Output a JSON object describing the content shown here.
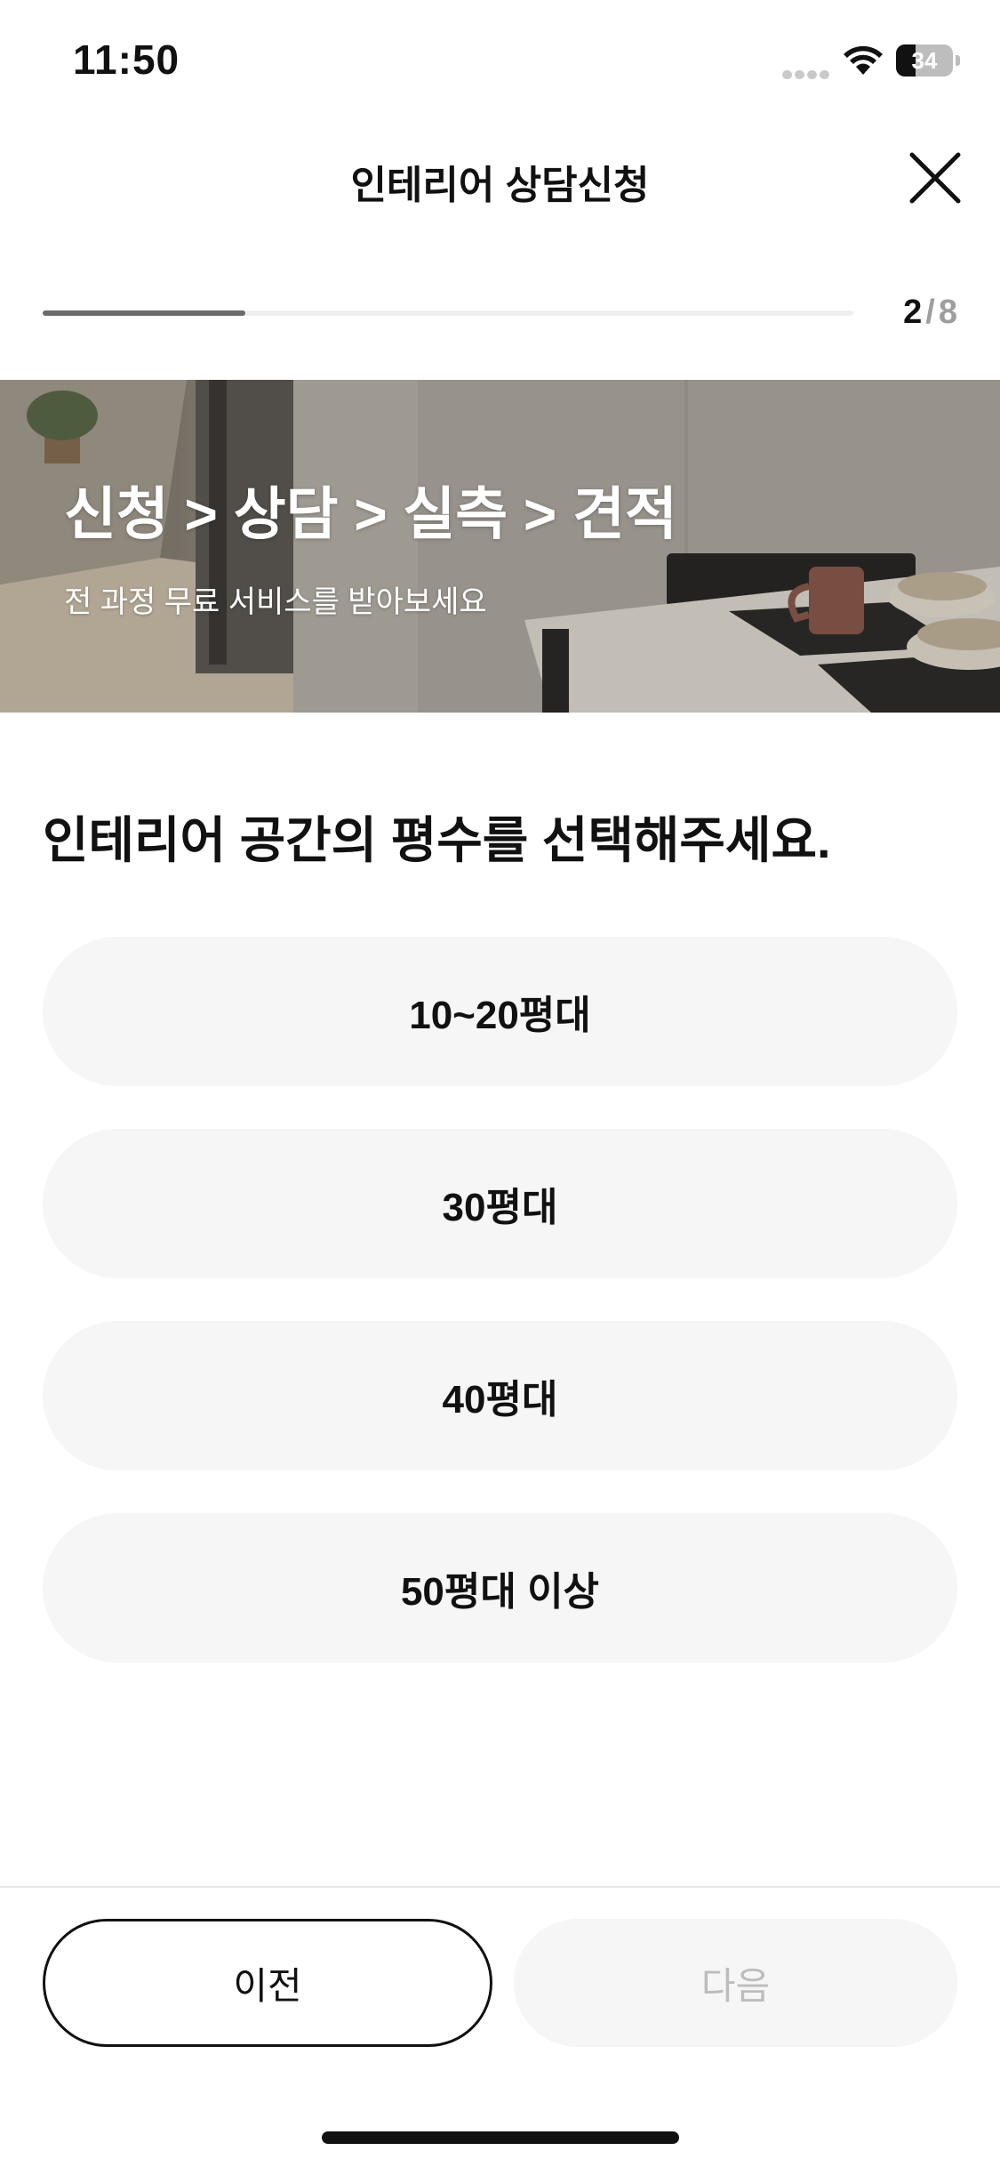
{
  "status_bar": {
    "time": "11:50",
    "battery_level": "34",
    "icons": [
      "signal-icon",
      "wifi-icon",
      "battery-icon"
    ]
  },
  "header": {
    "title": "인테리어 상담신청",
    "close_icon": "close-icon"
  },
  "progress": {
    "current": "2",
    "separator": "/",
    "total": "8",
    "fraction": 0.25
  },
  "banner": {
    "title": "신청 > 상담 > 실측 > 견적",
    "subtitle": "전 과정 무료 서비스를 받아보세요"
  },
  "question": {
    "title": "인테리어 공간의 평수를 선택해주세요."
  },
  "options": [
    {
      "label": "10~20평대"
    },
    {
      "label": "30평대"
    },
    {
      "label": "40평대"
    },
    {
      "label": "50평대 이상"
    }
  ],
  "footer": {
    "prev_label": "이전",
    "next_label": "다음"
  },
  "colors": {
    "option_bg": "#f6f6f6",
    "progress_fill": "#6b6b6b",
    "progress_track": "#efefef",
    "disabled_text": "#bdbdbd",
    "text": "#111111"
  }
}
